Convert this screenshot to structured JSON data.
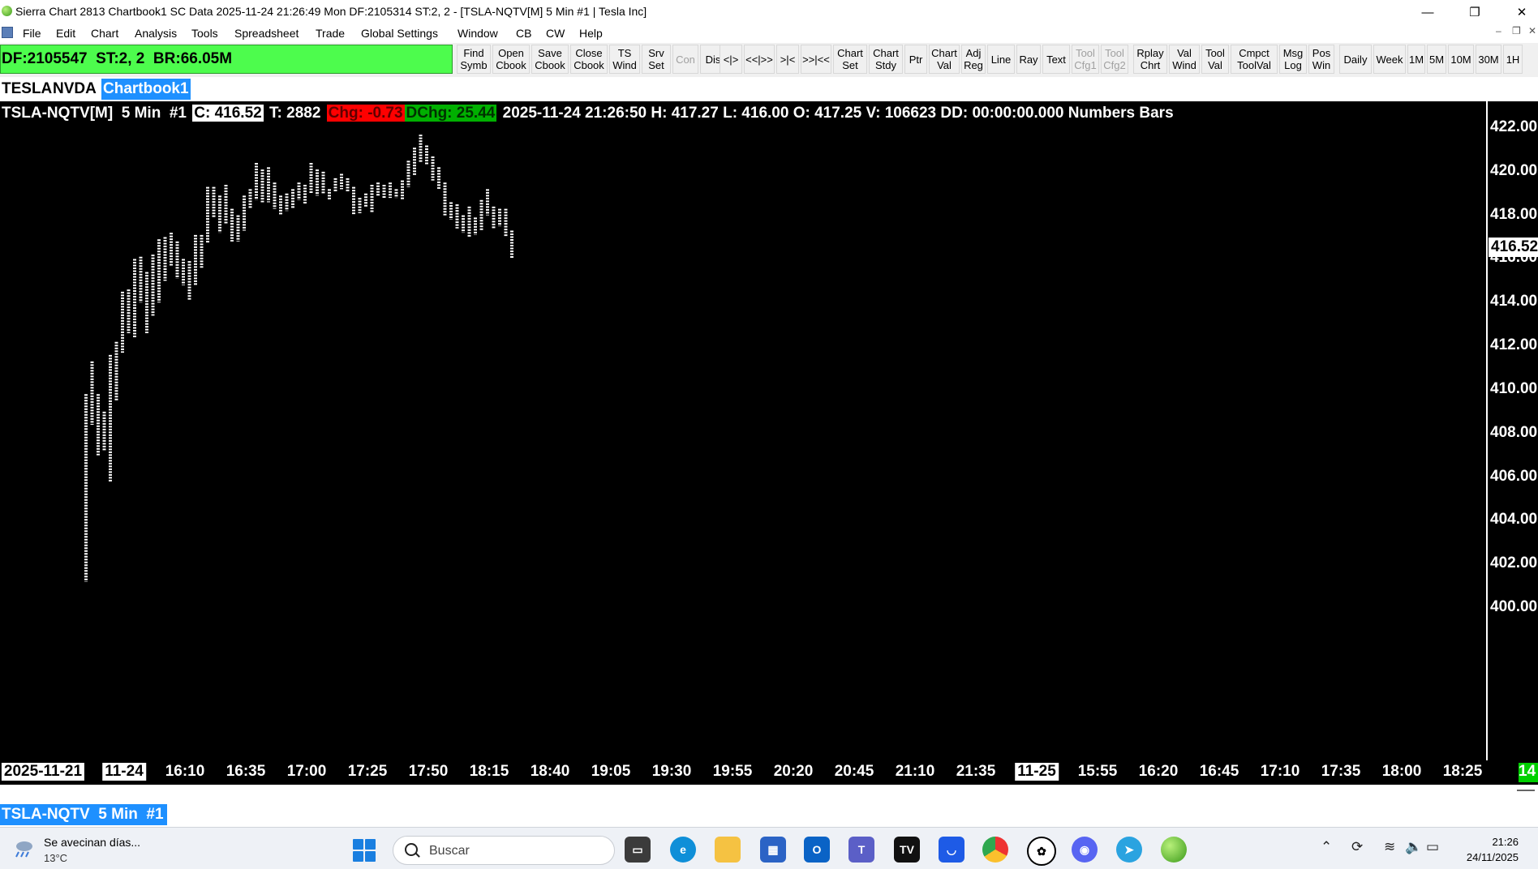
{
  "window": {
    "title": "Sierra Chart 2813 Chartbook1 SC Data 2025-11-24  21:26:49 Mon DF:2105314  ST:2, 2 - [TSLA-NQTV[M]  5 Min  #1 | Tesla Inc]",
    "controls": [
      "—",
      "❐",
      "✕"
    ]
  },
  "menu": {
    "items": [
      "File",
      "Edit",
      "Chart",
      "Analysis",
      "Tools",
      "Spreadsheet",
      "Trade",
      "Global Settings",
      "Window",
      "CB",
      "CW",
      "Help"
    ],
    "sub_controls": [
      "–",
      "❐",
      "✕"
    ]
  },
  "toolbar": {
    "status": "DF:2105547  ST:2, 2  BR:66.05M",
    "buttons": [
      {
        "label": "Find\nSymb"
      },
      {
        "label": "Open\nCbook"
      },
      {
        "label": "Save\nCbook"
      },
      {
        "label": "Close\nCbook"
      },
      {
        "label": "TS\nWind"
      },
      {
        "label": "Srv\nSet"
      },
      {
        "label": "Con"
      },
      {
        "label": "Dis"
      },
      {
        "label": "<|>"
      },
      {
        "label": "<<|>>"
      },
      {
        "label": ">|<"
      },
      {
        "label": ">>|<<"
      },
      {
        "label": "Chart\nSet"
      },
      {
        "label": "Chart\nStdy"
      },
      {
        "label": "Ptr"
      },
      {
        "label": "Chart\nVal"
      },
      {
        "label": "Adj\nReg"
      },
      {
        "label": "Line"
      },
      {
        "label": "Ray"
      },
      {
        "label": "Text"
      },
      {
        "label": "Tool\nCfg1"
      },
      {
        "label": "Tool\nCfg2"
      },
      {
        "label": "Rplay\nChrt"
      },
      {
        "label": "Val\nWind"
      },
      {
        "label": "Tool\nVal"
      },
      {
        "label": "Cmpct\nToolVal"
      },
      {
        "label": "Msg\nLog"
      },
      {
        "label": "Pos\nWin"
      },
      {
        "label": "Daily"
      },
      {
        "label": "Week"
      },
      {
        "label": "1M"
      },
      {
        "label": "5M"
      },
      {
        "label": "10M"
      },
      {
        "label": "30M"
      },
      {
        "label": "1H"
      }
    ]
  },
  "tabs": [
    "TESLA",
    "NVDA",
    "Chartbook1"
  ],
  "chart_header": {
    "symbol": "TSLA-NQTV[M]  5 Min  #1",
    "close": "C: 416.52",
    "trades": "T: 2882",
    "chg": "Chg: -0.73",
    "dchg": "DChg: 25.44",
    "rest": "2025-11-24 21:26:50 H: 417.27 L: 416.00 O: 417.25 V: 106623 DD: 00:00:00.000 Numbers Bars"
  },
  "colors": {
    "background": "#000000",
    "bars": "#ffffff",
    "active_tab": "#1e90ff",
    "status_green": "#4dfc4d",
    "chg_red": "#ff0000",
    "dchg_green": "#00b000"
  },
  "price_tag": "416.52",
  "chart_data": {
    "type": "bar",
    "style": "Numbers Bars",
    "price_axis": {
      "labels": [
        "422.00",
        "420.00",
        "418.00",
        "416.00",
        "414.00",
        "412.00",
        "410.00",
        "408.00",
        "406.00",
        "404.00",
        "402.00",
        "400.00"
      ],
      "ylim": [
        399.4,
        423.1
      ]
    },
    "time_axis": {
      "labels": [
        "2025-11-21",
        "11-24",
        "16:10",
        "16:35",
        "17:00",
        "17:25",
        "17:50",
        "18:15",
        "18:40",
        "19:05",
        "19:30",
        "19:55",
        "20:20",
        "20:45",
        "21:10",
        "21:35",
        "11-25",
        "15:55",
        "16:20",
        "16:45",
        "17:10",
        "17:35",
        "18:00",
        "18:25"
      ],
      "date_labels": [
        "2025-11-21",
        "11-24",
        "11-25"
      ]
    },
    "bars": [
      {
        "high": 409.8,
        "low": 401.2
      },
      {
        "high": 411.3,
        "low": 408.4
      },
      {
        "high": 409.8,
        "low": 407.0
      },
      {
        "high": 409.0,
        "low": 407.2
      },
      {
        "high": 411.6,
        "low": 405.8
      },
      {
        "high": 412.2,
        "low": 409.5
      },
      {
        "high": 414.5,
        "low": 411.7
      },
      {
        "high": 414.6,
        "low": 412.6
      },
      {
        "high": 416.0,
        "low": 412.4
      },
      {
        "high": 416.1,
        "low": 414.0
      },
      {
        "high": 415.4,
        "low": 412.6
      },
      {
        "high": 416.2,
        "low": 413.4
      },
      {
        "high": 416.9,
        "low": 414.0
      },
      {
        "high": 417.0,
        "low": 415.0
      },
      {
        "high": 417.2,
        "low": 415.7
      },
      {
        "high": 416.8,
        "low": 415.1
      },
      {
        "high": 416.0,
        "low": 414.8
      },
      {
        "high": 415.9,
        "low": 414.1
      },
      {
        "high": 417.1,
        "low": 414.8
      },
      {
        "high": 417.1,
        "low": 415.6
      },
      {
        "high": 419.3,
        "low": 416.7
      },
      {
        "high": 419.3,
        "low": 417.9
      },
      {
        "high": 418.9,
        "low": 417.2
      },
      {
        "high": 419.4,
        "low": 417.6
      },
      {
        "high": 418.3,
        "low": 416.8
      },
      {
        "high": 418.0,
        "low": 416.8
      },
      {
        "high": 418.9,
        "low": 417.3
      },
      {
        "high": 419.2,
        "low": 418.3
      },
      {
        "high": 420.4,
        "low": 418.7
      },
      {
        "high": 420.1,
        "low": 418.6
      },
      {
        "high": 420.2,
        "low": 418.6
      },
      {
        "high": 419.5,
        "low": 418.3
      },
      {
        "high": 418.9,
        "low": 418.0
      },
      {
        "high": 419.0,
        "low": 418.2
      },
      {
        "high": 419.2,
        "low": 418.3
      },
      {
        "high": 419.5,
        "low": 418.7
      },
      {
        "high": 419.4,
        "low": 418.5
      },
      {
        "high": 420.4,
        "low": 419.0
      },
      {
        "high": 420.1,
        "low": 418.9
      },
      {
        "high": 420.0,
        "low": 419.0
      },
      {
        "high": 419.2,
        "low": 418.7
      },
      {
        "high": 419.7,
        "low": 419.1
      },
      {
        "high": 419.9,
        "low": 419.2
      },
      {
        "high": 419.7,
        "low": 419.1
      },
      {
        "high": 419.3,
        "low": 418.0
      },
      {
        "high": 418.8,
        "low": 418.1
      },
      {
        "high": 419.0,
        "low": 418.4
      },
      {
        "high": 419.4,
        "low": 418.1
      },
      {
        "high": 419.5,
        "low": 418.9
      },
      {
        "high": 419.4,
        "low": 418.8
      },
      {
        "high": 419.5,
        "low": 418.8
      },
      {
        "high": 419.2,
        "low": 418.8
      },
      {
        "high": 419.6,
        "low": 418.7
      },
      {
        "high": 420.5,
        "low": 419.3
      },
      {
        "high": 421.1,
        "low": 419.8
      },
      {
        "high": 421.7,
        "low": 420.4
      },
      {
        "high": 421.2,
        "low": 420.3
      },
      {
        "high": 420.7,
        "low": 419.6
      },
      {
        "high": 420.2,
        "low": 419.2
      },
      {
        "high": 419.5,
        "low": 418.0
      },
      {
        "high": 418.6,
        "low": 417.8
      },
      {
        "high": 418.5,
        "low": 417.4
      },
      {
        "high": 418.0,
        "low": 417.2
      },
      {
        "high": 418.4,
        "low": 417.0
      },
      {
        "high": 417.9,
        "low": 417.1
      },
      {
        "high": 418.7,
        "low": 417.3
      },
      {
        "high": 419.2,
        "low": 418.0
      },
      {
        "high": 418.4,
        "low": 417.4
      },
      {
        "high": 418.3,
        "low": 417.5
      },
      {
        "high": 418.3,
        "low": 417.0
      },
      {
        "high": 417.3,
        "low": 416.0
      }
    ]
  },
  "bottom_tab": "TSLA-NQTV  5 Min  #1",
  "taskbar": {
    "weather_text": "Se avecinan días...",
    "weather_temp": "13°C",
    "search_placeholder": "Buscar",
    "apps": [
      "file-explorer-icon",
      "edge-icon",
      "folder-icon",
      "store-icon",
      "outlook-icon",
      "teams-icon",
      "tradingview-icon",
      "inbox-icon",
      "chrome-icon",
      "chatgpt-icon",
      "discord-icon",
      "telegram-icon",
      "sierra-chart-icon"
    ],
    "time": "21:26",
    "date": "24/11/2025"
  }
}
